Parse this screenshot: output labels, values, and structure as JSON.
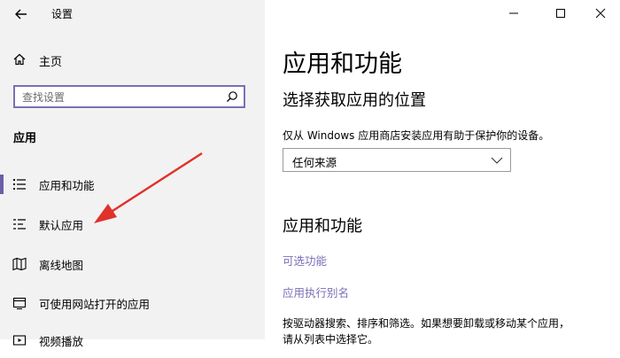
{
  "window": {
    "title": "设置"
  },
  "sidebar": {
    "home_label": "主页",
    "search_placeholder": "查找设置",
    "section_title": "应用",
    "items": [
      {
        "label": "应用和功能",
        "icon": "apps-features-icon",
        "selected": true
      },
      {
        "label": "默认应用",
        "icon": "default-apps-icon",
        "selected": false
      },
      {
        "label": "离线地图",
        "icon": "offline-maps-icon",
        "selected": false
      },
      {
        "label": "可使用网站打开的应用",
        "icon": "apps-for-websites-icon",
        "selected": false
      },
      {
        "label": "视频播放",
        "icon": "video-playback-icon",
        "selected": false
      }
    ]
  },
  "main": {
    "page_title": "应用和功能",
    "install_section": {
      "heading": "选择获取应用的位置",
      "description": "仅从 Windows 应用商店安装应用有助于保护你的设备。",
      "dropdown_value": "任何来源"
    },
    "apps_section": {
      "heading": "应用和功能",
      "links": [
        "可选功能",
        "应用执行别名"
      ],
      "paragraph_line1": "按驱动器搜索、排序和筛选。如果想要卸载或移动某个应用，",
      "paragraph_line2": "请从列表中选择它。"
    }
  },
  "colors": {
    "accent": "#6a5fa9",
    "link": "#7a6fb6",
    "annotation_arrow": "#e0312b"
  }
}
